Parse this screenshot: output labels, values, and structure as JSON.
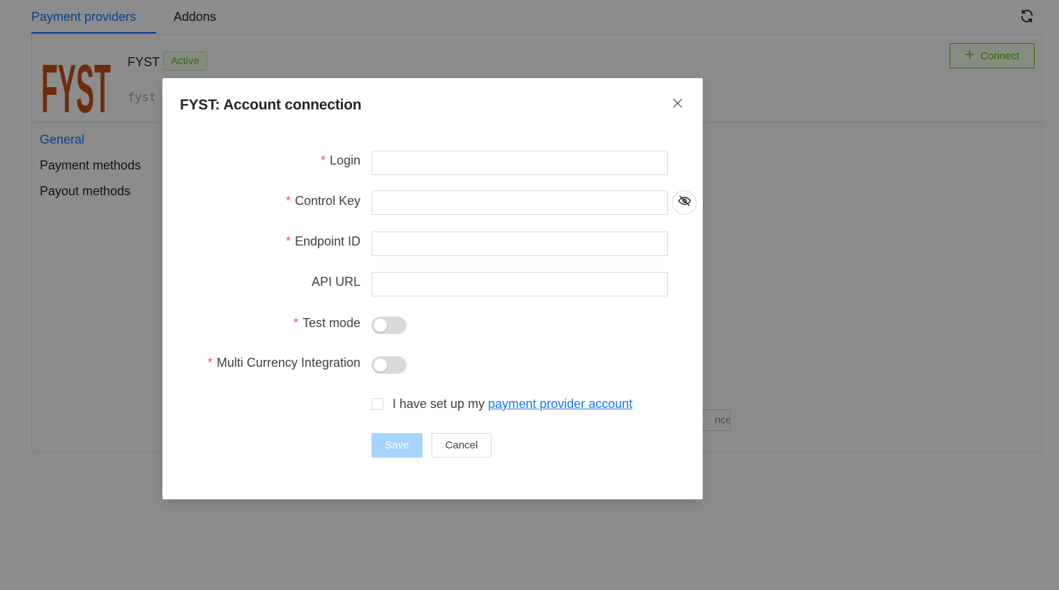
{
  "tabs": [
    {
      "label": "Payment providers",
      "active": true
    },
    {
      "label": "Addons",
      "active": false
    }
  ],
  "toolbar": {
    "refresh_icon": "refresh-icon"
  },
  "provider": {
    "logo_text": "FYST",
    "name": "FYST",
    "status": "Active",
    "code": "fyst",
    "connect_label": "Connect"
  },
  "side_nav": [
    {
      "label": "General",
      "active": true
    },
    {
      "label": "Payment methods",
      "active": false
    },
    {
      "label": "Payout methods",
      "active": false
    }
  ],
  "background_button_fragment": "nce",
  "modal": {
    "title": "FYST: Account connection",
    "fields": {
      "login": {
        "label": "Login",
        "required": true,
        "value": ""
      },
      "control_key": {
        "label": "Control Key",
        "required": true,
        "value": ""
      },
      "endpoint_id": {
        "label": "Endpoint ID",
        "required": true,
        "value": ""
      },
      "api_url": {
        "label": "API URL",
        "required": false,
        "value": ""
      },
      "test_mode": {
        "label": "Test mode",
        "required": true,
        "on": false
      },
      "multi_currency": {
        "label": "Multi Currency Integration",
        "required": true,
        "on": false
      }
    },
    "agreement": {
      "text": "I have set up my",
      "link": "payment provider account",
      "checked": false
    },
    "save_label": "Save",
    "cancel_label": "Cancel"
  },
  "colors": {
    "accent": "#1677ff",
    "success": "#52c41a",
    "required": "#ff4d4f",
    "logo": "#c8501a"
  }
}
